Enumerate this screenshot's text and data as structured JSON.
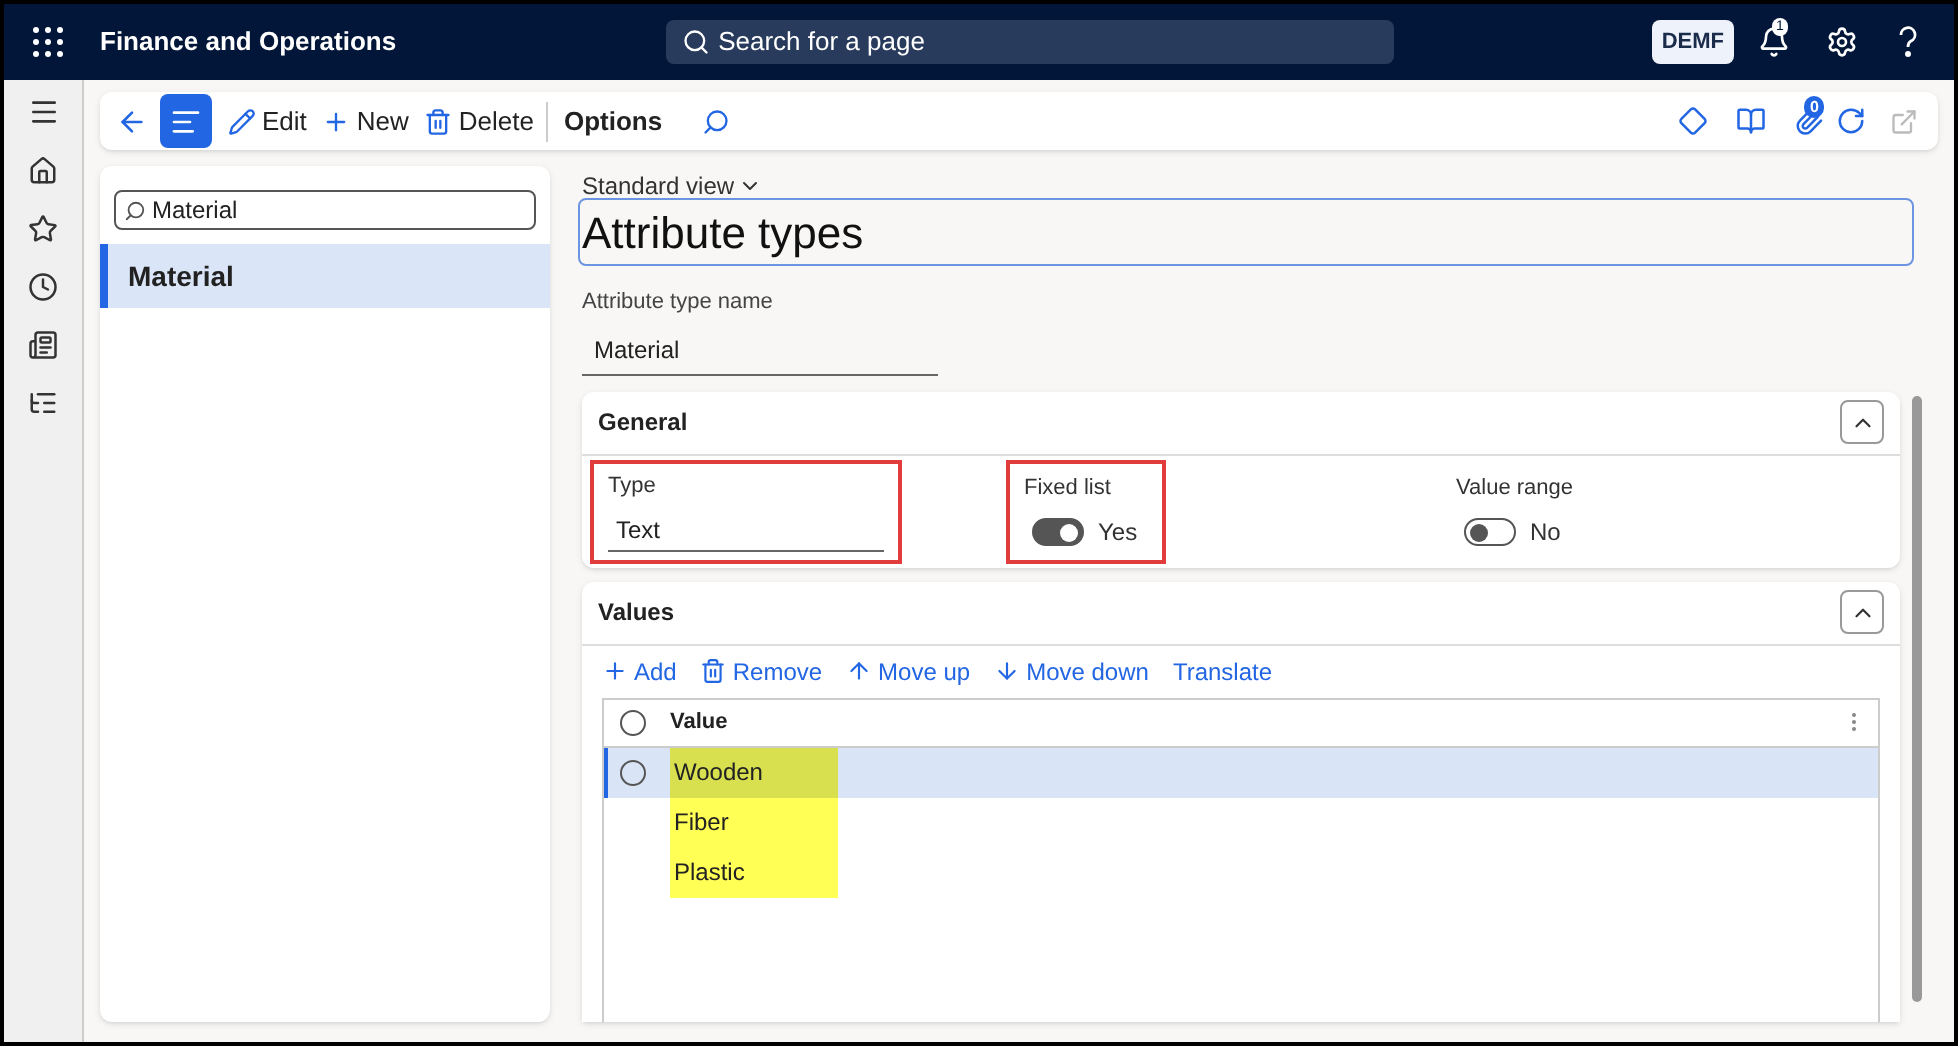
{
  "app": {
    "title": "Finance and Operations",
    "search_placeholder": "Search for a page",
    "company": "DEMF",
    "notification_count": "1"
  },
  "toolbar": {
    "buttons": [
      {
        "label": "Edit",
        "kind": "edit"
      },
      {
        "label": "New",
        "kind": "new"
      },
      {
        "label": "Delete",
        "kind": "delete"
      }
    ],
    "options": "Options",
    "attachment_count": "0"
  },
  "list_panel": {
    "filter": "Material",
    "items": [
      {
        "label": "Material",
        "selected": true
      }
    ]
  },
  "form": {
    "view": "Standard view",
    "title": "Attribute types",
    "name_label": "Attribute type name",
    "name_value": "Material"
  },
  "general": {
    "title": "General",
    "expanded": true,
    "fields": [
      {
        "kind": "text",
        "label": "Type",
        "value": "Text",
        "highlighted": true
      },
      {
        "kind": "toggle",
        "label": "Fixed list",
        "on": true,
        "value": "Yes",
        "highlighted": true
      },
      {
        "kind": "toggle",
        "label": "Value range",
        "on": false,
        "value": "No",
        "highlighted": false
      }
    ]
  },
  "values": {
    "title": "Values",
    "expanded": true,
    "actions": [
      {
        "label": "Add",
        "kind": "add"
      },
      {
        "label": "Remove",
        "kind": "remove"
      },
      {
        "label": "Move up",
        "kind": "up"
      },
      {
        "label": "Move down",
        "kind": "down"
      },
      {
        "label": "Translate",
        "kind": "plain"
      }
    ],
    "column": "Value",
    "all_selected": false,
    "rows": [
      {
        "value": "Wooden",
        "selected": true,
        "highlighted": true
      },
      {
        "value": "Fiber",
        "selected": false,
        "highlighted": true
      },
      {
        "value": "Plastic",
        "selected": false,
        "highlighted": true
      }
    ]
  }
}
